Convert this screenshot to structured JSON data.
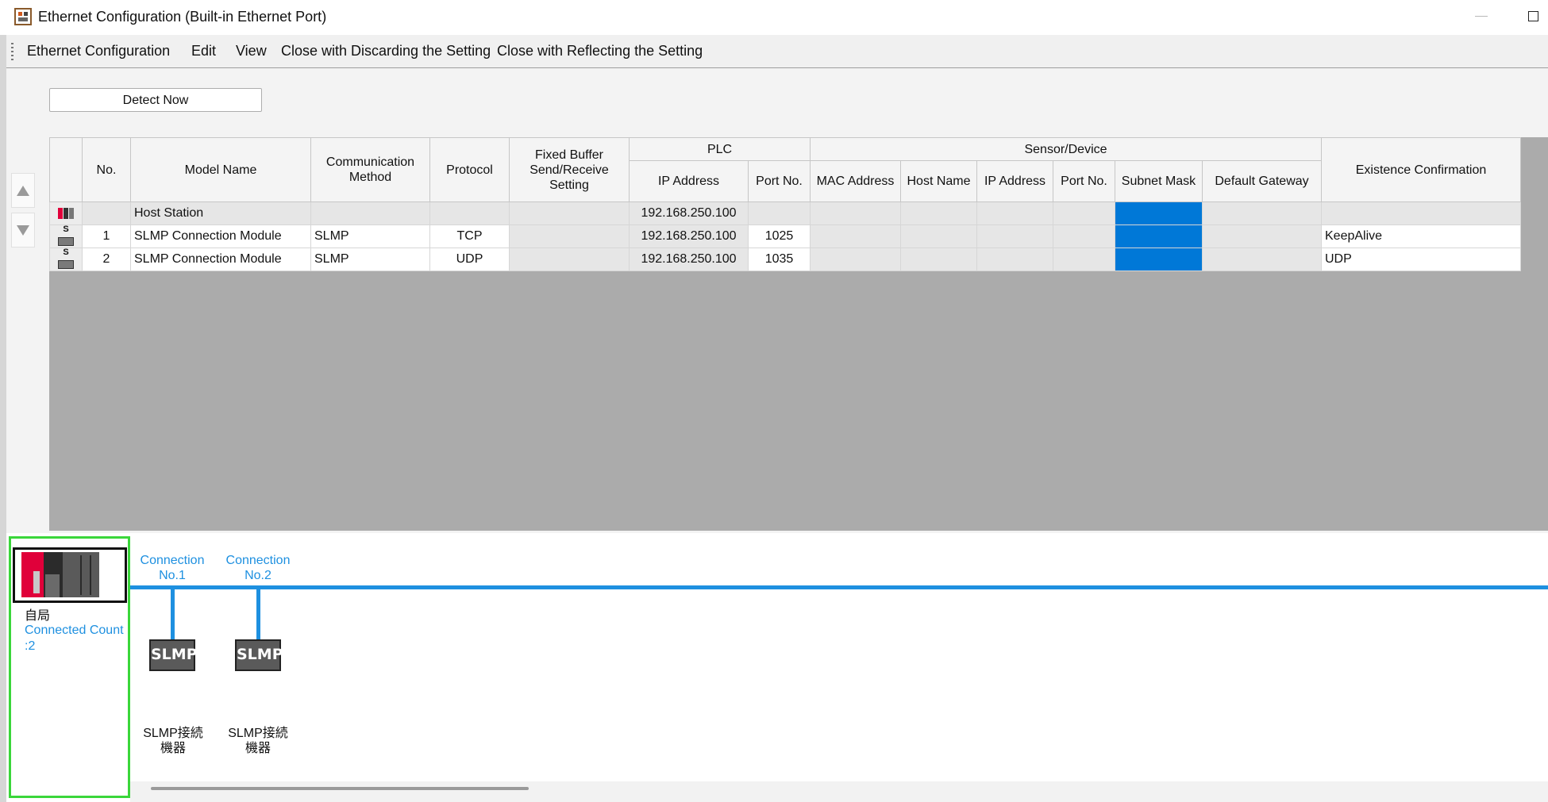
{
  "window": {
    "title": "Ethernet Configuration (Built-in Ethernet Port)"
  },
  "menu": {
    "items": [
      "Ethernet Configuration",
      "Edit",
      "View",
      "Close with Discarding the Setting",
      "Close with Reflecting the Setting"
    ]
  },
  "toolbar": {
    "detect_label": "Detect Now"
  },
  "grid": {
    "headers": {
      "no": "No.",
      "model": "Model Name",
      "comm": "Communication Method",
      "protocol": "Protocol",
      "fixed": "Fixed Buffer Send/Receive Setting",
      "plc": "PLC",
      "plc_ip": "IP Address",
      "plc_port": "Port No.",
      "sensor": "Sensor/Device",
      "mac": "MAC Address",
      "host": "Host Name",
      "s_ip": "IP Address",
      "s_port": "Port No.",
      "subnet": "Subnet Mask",
      "gateway": "Default Gateway",
      "existence": "Existence Confirmation"
    },
    "rows": [
      {
        "no": "",
        "model": "Host Station",
        "comm": "",
        "protocol": "",
        "fixed": "",
        "plc_ip": "192.168.250.100",
        "plc_port": "",
        "existence": "",
        "icon": "host-station-icon"
      },
      {
        "no": "1",
        "model": "SLMP Connection Module",
        "comm": "SLMP",
        "protocol": "TCP",
        "fixed": "",
        "plc_ip": "192.168.250.100",
        "plc_port": "1025",
        "existence": "KeepAlive",
        "icon": "slmp-module-icon"
      },
      {
        "no": "2",
        "model": "SLMP Connection Module",
        "comm": "SLMP",
        "protocol": "UDP",
        "fixed": "",
        "plc_ip": "192.168.250.100",
        "plc_port": "1035",
        "existence": "UDP",
        "icon": "slmp-module-icon"
      }
    ]
  },
  "diagram": {
    "station_name": "自局",
    "connected_count": "Connected Count :2",
    "connections": [
      {
        "label": "Connection No.1",
        "device_badge": "SLMP",
        "device_label": "SLMP接続 機器"
      },
      {
        "label": "Connection No.2",
        "device_badge": "SLMP",
        "device_label": "SLMP接続 機器"
      }
    ]
  },
  "colors": {
    "accent_blue": "#1e90e0",
    "selection_blue": "#0078d7",
    "station_frame": "#3ad63a",
    "plc_red": "#e0003a",
    "grid_background": "#ababab"
  }
}
